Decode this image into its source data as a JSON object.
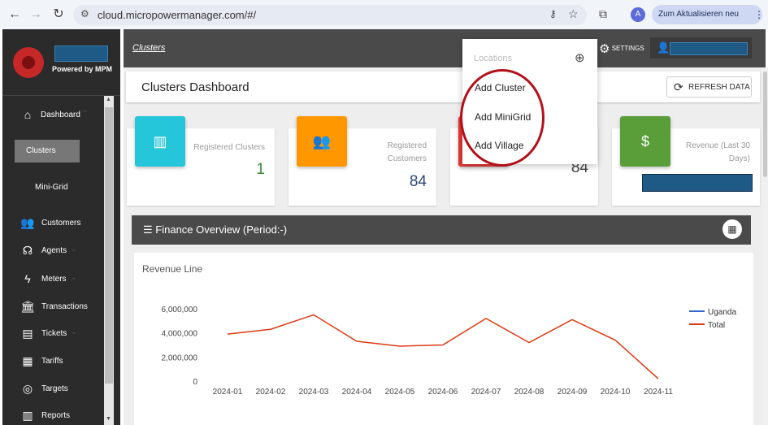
{
  "browser": {
    "url": "cloud.micropowermanager.com/#/",
    "profile_initial": "A",
    "update_label": "Zum Aktualisieren neu starten"
  },
  "sidebar": {
    "powered_by": "Powered by MPM",
    "items": [
      {
        "label": "Dashboard",
        "icon": "home-icon"
      },
      {
        "label": "Clusters",
        "icon": ""
      },
      {
        "label": "Mini-Grid",
        "icon": ""
      },
      {
        "label": "Customers",
        "icon": "people-icon"
      },
      {
        "label": "Agents",
        "icon": "headset-icon"
      },
      {
        "label": "Meters",
        "icon": "bolt-icon"
      },
      {
        "label": "Transactions",
        "icon": "bank-icon"
      },
      {
        "label": "Tickets",
        "icon": "ticket-icon"
      },
      {
        "label": "Tariffs",
        "icon": "tariff-icon"
      },
      {
        "label": "Targets",
        "icon": "target-icon"
      },
      {
        "label": "Reports",
        "icon": "report-icon"
      }
    ]
  },
  "topbar": {
    "breadcrumb": "Clusters",
    "settings_label": "SETTINGS"
  },
  "dashboard": {
    "title": "Clusters Dashboard",
    "refresh_label": "REFRESH DATA"
  },
  "cards": [
    {
      "label": "Registered Clusters",
      "value": "1",
      "color": "#26c6da",
      "icon": "map-icon"
    },
    {
      "label": "Registered Customers",
      "value": "84",
      "color": "#ff9800",
      "icon": "people-icon"
    },
    {
      "label": "",
      "value": "84",
      "color": "#e53935",
      "icon": ""
    },
    {
      "label": "Revenue (Last 30 Days)",
      "value": "",
      "color": "#5a9e3a",
      "icon": "dollar-icon"
    }
  ],
  "finance": {
    "title": "Finance Overview (Period:-)"
  },
  "dropdown": {
    "header": "Locations",
    "items": [
      "Add Cluster",
      "Add MiniGrid",
      "Add Village"
    ]
  },
  "chart_data": {
    "type": "line",
    "title": "Revenue Line",
    "x": [
      "2024-01",
      "2024-02",
      "2024-03",
      "2024-04",
      "2024-05",
      "2024-06",
      "2024-07",
      "2024-08",
      "2024-09",
      "2024-10",
      "2024-11"
    ],
    "series": [
      {
        "name": "Uganda",
        "color": "#3366cc",
        "values": []
      },
      {
        "name": "Total",
        "color": "#dc3912",
        "values": [
          3900000,
          4300000,
          5500000,
          3300000,
          2900000,
          3000000,
          5200000,
          3200000,
          5100000,
          3400000,
          200000
        ]
      }
    ],
    "yticks": [
      "6,000,000",
      "4,000,000",
      "2,000,000",
      "0"
    ],
    "ylim": [
      0,
      6000000
    ],
    "legend": "right"
  }
}
